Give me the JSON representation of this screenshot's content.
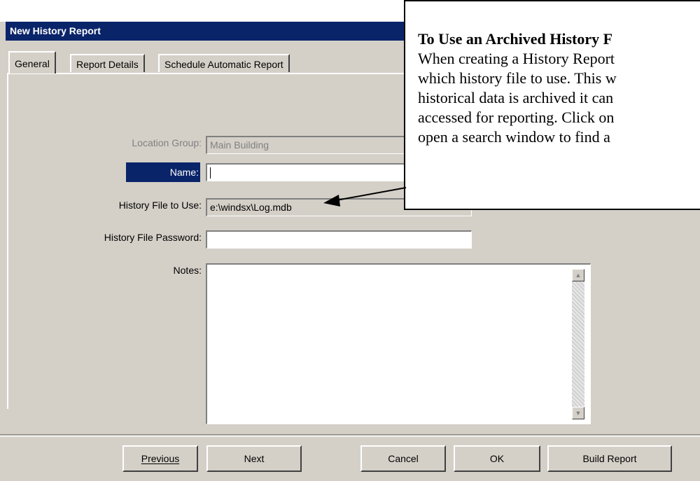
{
  "window": {
    "title": "New History Report"
  },
  "tabs": [
    {
      "label": "General",
      "active": true
    },
    {
      "label": "Report Details",
      "active": false
    },
    {
      "label": "Schedule Automatic Report",
      "active": false
    }
  ],
  "form": {
    "location_group": {
      "label": "Location Group:",
      "value": "Main Building",
      "disabled": true
    },
    "name": {
      "label": "Name:",
      "value": ""
    },
    "history_file": {
      "label": "History File to Use:",
      "value": "e:\\windsx\\Log.mdb"
    },
    "history_password": {
      "label": "History File Password:",
      "value": ""
    },
    "notes": {
      "label": "Notes:",
      "value": ""
    }
  },
  "buttons": {
    "previous": "Previous",
    "next": "Next",
    "cancel": "Cancel",
    "ok": "OK",
    "build_report": "Build Report"
  },
  "callout": {
    "title": "To Use an Archived History F",
    "lines": [
      "When creating a History Report",
      "which history file to use. This w",
      "historical data is archived it can",
      "accessed for reporting. Click on",
      "open a search window to find a"
    ]
  },
  "colors": {
    "titlebar": "#0a246a",
    "face": "#d4d0c8",
    "highlight": "#0a246a"
  }
}
